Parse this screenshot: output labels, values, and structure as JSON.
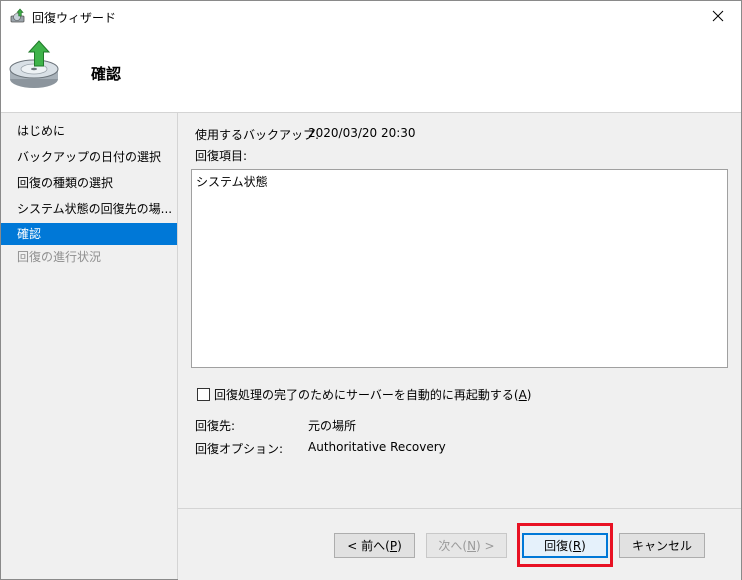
{
  "window": {
    "title": "回復ウィザード"
  },
  "header": {
    "title": "確認"
  },
  "nav": {
    "items": [
      {
        "label": "はじめに"
      },
      {
        "label": "バックアップの日付の選択"
      },
      {
        "label": "回復の種類の選択"
      },
      {
        "label": "システム状態の回復先の場..."
      },
      {
        "label": "確認"
      },
      {
        "label": "回復の進行状況"
      }
    ],
    "active_index": 4
  },
  "main": {
    "backup_label": "使用するバックアップ:",
    "backup_value": "2020/03/20 20:30",
    "items_label": "回復項目:",
    "items_list": [
      "システム状態"
    ],
    "restart_checkbox": {
      "label_prefix": "回復処理の完了のためにサーバーを自動的に再起動する(",
      "accel": "A",
      "label_suffix": ")",
      "checked": false
    },
    "destination_label": "回復先:",
    "destination_value": "元の場所",
    "options_label": "回復オプション:",
    "options_value": "Authoritative Recovery"
  },
  "footer": {
    "back": {
      "prefix": "< 前へ(",
      "accel": "P",
      "suffix": ")"
    },
    "next": {
      "prefix": "次へ(",
      "accel": "N",
      "suffix": ") >"
    },
    "recover": {
      "prefix": "回復(",
      "accel": "R",
      "suffix": ")"
    },
    "cancel": "キャンセル"
  },
  "colors": {
    "accent": "#0078d7",
    "highlight": "#e81123",
    "panel": "#f0f0f0"
  },
  "icons": [
    "wizard-app-icon",
    "close-icon",
    "backup-disk-icon",
    "checkbox-icon"
  ]
}
